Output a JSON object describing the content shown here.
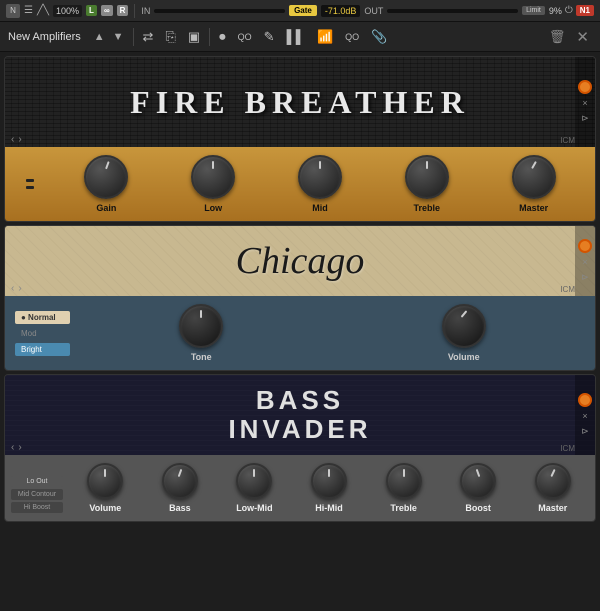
{
  "topbar": {
    "logo": "N",
    "hamburger": "☰",
    "percent": "100%",
    "badge_l": "L",
    "badge_m": "∞",
    "badge_r": "R",
    "in_label": "IN",
    "gate_label": "Gate",
    "db_value": "-71.0dB",
    "out_label": "OUT",
    "limit_label": "Limit",
    "pct_right": "9%",
    "ni_label": "N1"
  },
  "toolbar": {
    "title": "New Amplifiers",
    "arrow_up": "▲",
    "arrow_down": "▼",
    "shuffle_icon": "⇄",
    "copy_icon": "⎘",
    "save_icon": "💾",
    "rec_icon": "⏺",
    "eq_icon": "QO",
    "pencil_icon": "✎",
    "bar_icon": "▌▌",
    "chart_icon": "📊",
    "qo_icon": "QO",
    "clip_icon": "📎",
    "trash_icon": "🗑",
    "close_icon": "✕"
  },
  "amps": {
    "fire_breather": {
      "name": "FIRE BREATHER",
      "icm": "ICM",
      "knobs": [
        {
          "label": "Gain",
          "value": 6
        },
        {
          "label": "Low",
          "value": 5
        },
        {
          "label": "Mid",
          "value": 5
        },
        {
          "label": "Treble",
          "value": 5
        },
        {
          "label": "Master",
          "value": 7
        }
      ]
    },
    "chicago": {
      "name": "Chicago",
      "icm": "ICM",
      "modes": [
        "Normal",
        "Mod",
        "Bright"
      ],
      "knobs": [
        {
          "label": "Tone",
          "value": 5
        },
        {
          "label": "Volume",
          "value": 7
        }
      ]
    },
    "bass_invader": {
      "name_line1": "BASS",
      "name_line2": "INVADER",
      "icm": "ICM",
      "modes": [
        "Lo Out",
        "Mid Contour",
        "Hi Boost"
      ],
      "knobs": [
        {
          "label": "Volume",
          "value": 5
        },
        {
          "label": "Bass",
          "value": 6
        },
        {
          "label": "Low-Mid",
          "value": 5
        },
        {
          "label": "Hi-Mid",
          "value": 5
        },
        {
          "label": "Treble",
          "value": 5
        },
        {
          "label": "Boost",
          "value": 4
        },
        {
          "label": "Master",
          "value": 6
        }
      ]
    }
  }
}
